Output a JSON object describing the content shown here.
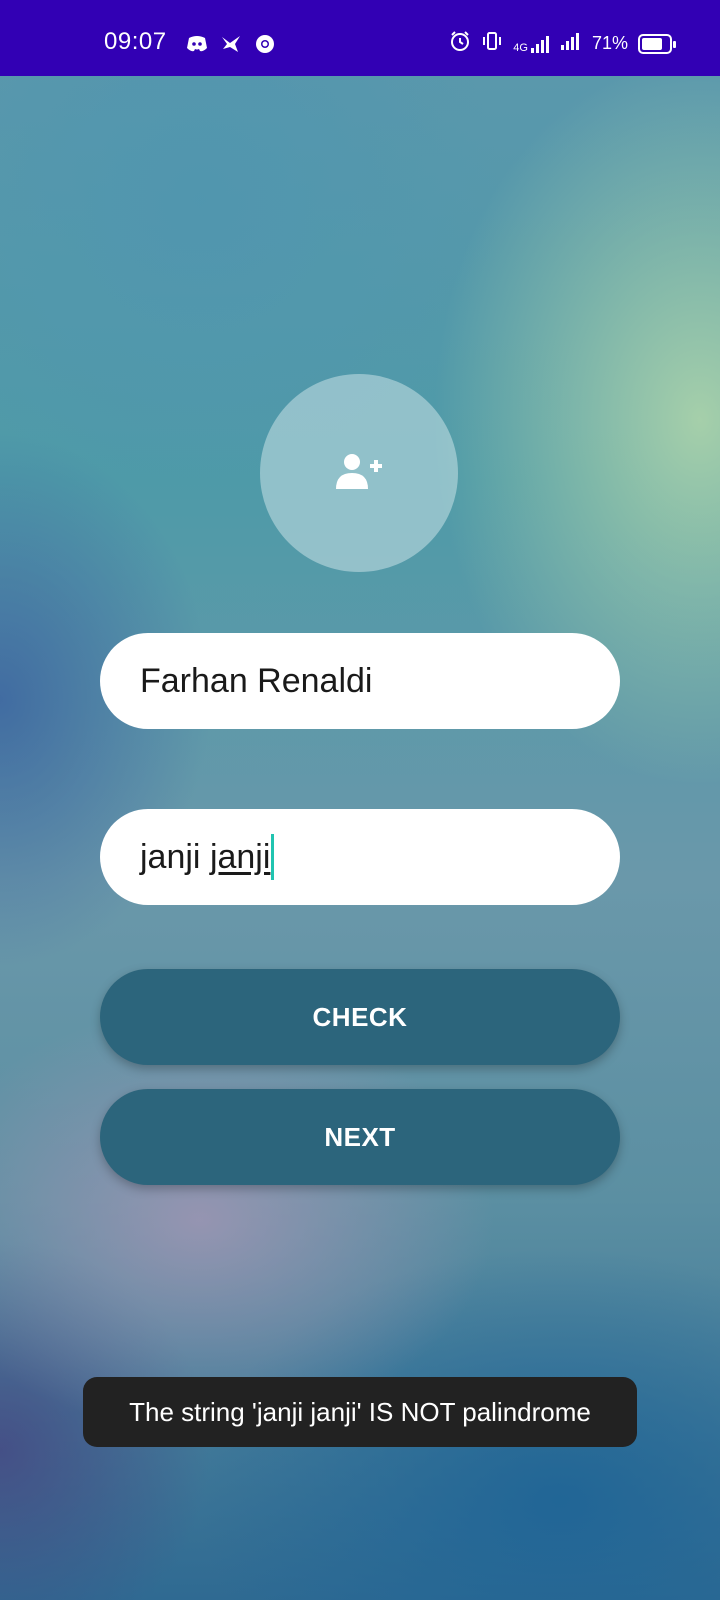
{
  "status_bar": {
    "time": "09:07",
    "network": "4G",
    "battery_text": "71%",
    "battery_level": 0.71,
    "left_icons": [
      "discord-icon",
      "bird-app-icon",
      "chrome-icon"
    ],
    "right_icons": [
      "alarm-icon",
      "vibrate-icon",
      "signal-4g-icon",
      "signal-icon",
      "battery-icon"
    ],
    "background_color": "#3200b4"
  },
  "avatar": {
    "icon": "add-user-icon"
  },
  "form": {
    "name_value": "Farhan Renaldi",
    "text_prefix": "janji ",
    "text_composing": "janji"
  },
  "buttons": {
    "check_label": "CHECK",
    "next_label": "NEXT",
    "color": "#2c657c"
  },
  "toast": {
    "message": "The string 'janji janji' IS NOT palindrome"
  }
}
